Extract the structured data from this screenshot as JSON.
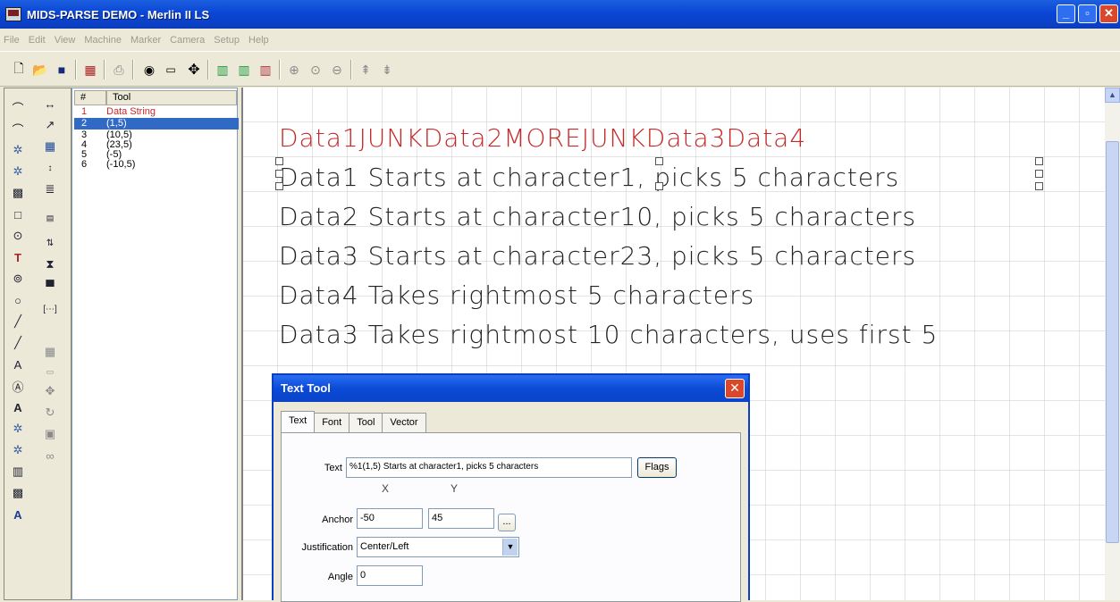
{
  "window": {
    "title": "MIDS-PARSE DEMO - Merlin II LS",
    "min": "_",
    "max": "▫",
    "close": "✕"
  },
  "menu": [
    "File",
    "Edit",
    "View",
    "Machine",
    "Marker",
    "Camera",
    "Setup",
    "Help"
  ],
  "tool_list": {
    "headers": [
      "#",
      "Tool"
    ],
    "rows": [
      {
        "num": "1",
        "tool": "Data String"
      },
      {
        "num": "2",
        "tool": "(1,5)"
      },
      {
        "num": "3",
        "tool": "(10,5)"
      },
      {
        "num": "4",
        "tool": "(23,5)"
      },
      {
        "num": "5",
        "tool": "(-5)"
      },
      {
        "num": "6",
        "tool": "(-10,5)"
      }
    ]
  },
  "canvas_lines": [
    "Data1JUNKData2MOREJUNKData3Data4",
    "Data1 Starts at character1, picks 5 characters",
    "Data2 Starts at character10, picks 5 characters",
    "Data3 Starts at character23, picks 5 characters",
    "Data4 Takes rightmost 5 characters",
    "Data3 Takes rightmost 10 characters, uses first 5"
  ],
  "dialog": {
    "title": "Text Tool",
    "close": "✕",
    "tabs": [
      "Text",
      "Font",
      "Tool",
      "Vector"
    ],
    "text_label": "Text",
    "text_value": "%1(1,5) Starts at character1, picks 5 characters",
    "flags_label": "Flags",
    "x_label": "X",
    "y_label": "Y",
    "anchor_label": "Anchor",
    "anchor_x": "-50",
    "anchor_y": "45",
    "anchor_more": "...",
    "justification_label": "Justification",
    "justification_value": "Center/Left",
    "angle_label": "Angle",
    "angle_value": "0"
  },
  "colors": {
    "title_bar": "#0a46d4",
    "selection": "#316ac5",
    "red_text": "#c62929"
  }
}
